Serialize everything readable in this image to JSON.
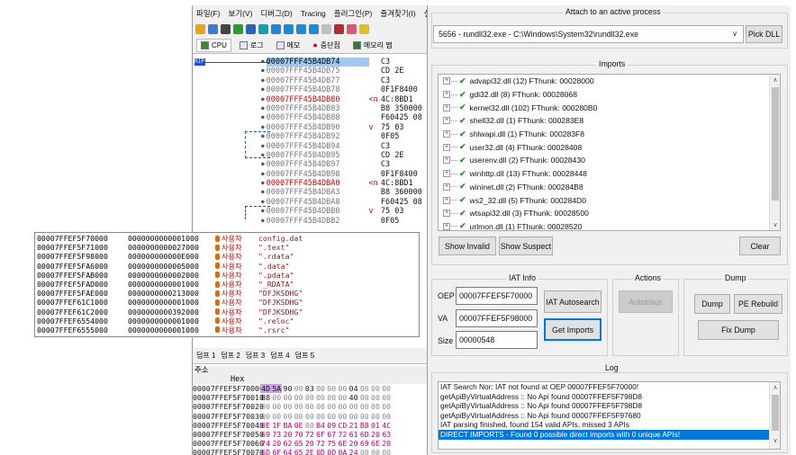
{
  "debugger": {
    "menu": [
      "파일(F)",
      "보기(V)",
      "디버그(D)",
      "Tracing",
      "플러그인(P)",
      "즐겨찾기(I)",
      "설"
    ],
    "tabs": [
      "CPU",
      "로그",
      "메모",
      "중단점",
      "메모리 맵"
    ],
    "rip_label": "RIP",
    "disasm_rows": [
      {
        "addr": "00007FFF45B4DB74",
        "bytes": "C3",
        "selected": true
      },
      {
        "addr": "00007FFF45B4DB75",
        "bytes": "CD 2E"
      },
      {
        "addr": "00007FFF45B4DB77",
        "bytes": "C3"
      },
      {
        "addr": "00007FFF45B4DB78",
        "bytes": "0F1F8400"
      },
      {
        "addr": "00007FFF45B4DB80",
        "bytes": "4C:8BD1",
        "red": true,
        "marker": "<n"
      },
      {
        "addr": "00007FFF45B4DB83",
        "bytes": "B8 350000"
      },
      {
        "addr": "00007FFF45B4DB88",
        "bytes": "F60425 08"
      },
      {
        "addr": "00007FFF45B4DB90",
        "bytes": "75 03",
        "marker": "v"
      },
      {
        "addr": "00007FFF45B4DB92",
        "bytes": "0F05"
      },
      {
        "addr": "00007FFF45B4DB94",
        "bytes": "C3"
      },
      {
        "addr": "00007FFF45B4DB95",
        "bytes": "CD 2E"
      },
      {
        "addr": "00007FFF45B4DB97",
        "bytes": "C3"
      },
      {
        "addr": "00007FFF45B4DB98",
        "bytes": "0F1F8400"
      },
      {
        "addr": "00007FFF45B4DBA0",
        "bytes": "4C:8BD1",
        "red": true,
        "marker": "<n"
      },
      {
        "addr": "00007FFF45B4DBA3",
        "bytes": "B8 360000"
      },
      {
        "addr": "00007FFF45B4DBA8",
        "bytes": "F60425 08"
      },
      {
        "addr": "00007FFF45B4DBB0",
        "bytes": "75 03",
        "marker": "v"
      },
      {
        "addr": "00007FFF45B4DBB2",
        "bytes": "0F05"
      }
    ],
    "dump_tabs": [
      "덤프 1",
      "덤프 2",
      "덤프 3",
      "덤프 4",
      "덤프 5"
    ],
    "dump_col_addr": "주소",
    "dump_col_hex": "Hex",
    "dump_rows": [
      {
        "addr": "00007FFEF5F70000",
        "hex": "4D 5A 90 00 03 00 00 00 04 00 00 00"
      },
      {
        "addr": "00007FFEF5F70010",
        "hex": "B8 00 00 00 00 00 00 00 40 00 00 00"
      },
      {
        "addr": "00007FFEF5F70020",
        "hex": "00 00 00 00 00 00 00 00 00 00 00 00"
      },
      {
        "addr": "00007FFEF5F70030",
        "hex": "00 00 00 00 00 00 00 00 00 00 00 00"
      },
      {
        "addr": "00007FFEF5F70040",
        "hex": "0E 1F BA 0E 00 B4 09 CD 21 B8 01 4C"
      },
      {
        "addr": "00007FFEF5F70050",
        "hex": "69 73 20 70 72 6F 67 72 61 6D 20 63"
      },
      {
        "addr": "00007FFEF5F70060",
        "hex": "74 20 62 65 20 72 75 6E 20 69 6E 20"
      },
      {
        "addr": "00007FFEF5F70070",
        "hex": "6D 6F 64 65 2E 0D 0D 0A 24 00 00 00"
      }
    ]
  },
  "memmap": {
    "rows": [
      {
        "addr": "00007FFEF5F70000",
        "size": "0000000000001000",
        "type": "사용자",
        "info": "config.dat"
      },
      {
        "addr": "00007FFEF5F71000",
        "size": "0000000000027000",
        "type": "사용자",
        "info": "\".text\""
      },
      {
        "addr": "00007FFEF5F98000",
        "size": "000000000000E000",
        "type": "사용자",
        "info": "\".rdata\""
      },
      {
        "addr": "00007FFEF5FA6000",
        "size": "0000000000005000",
        "type": "사용자",
        "info": "\".data\""
      },
      {
        "addr": "00007FFEF5FAB000",
        "size": "0000000000002000",
        "type": "사용자",
        "info": "\".pdata\""
      },
      {
        "addr": "00007FFEF5FAD000",
        "size": "0000000000001000",
        "type": "사용자",
        "info": "\"_RDATA\""
      },
      {
        "addr": "00007FFEF5FAE000",
        "size": "0000000000213000",
        "type": "사용자",
        "info": "\"DFJKSDHG\""
      },
      {
        "addr": "00007FFEF61C1000",
        "size": "0000000000001000",
        "type": "사용자",
        "info": "\"DFJKSDHG\""
      },
      {
        "addr": "00007FFEF61C2000",
        "size": "0000000000392000",
        "type": "사용자",
        "info": "\"DFJKSDHG\""
      },
      {
        "addr": "00007FFEF6554000",
        "size": "0000000000001000",
        "type": "사용자",
        "info": "\".reloc\""
      },
      {
        "addr": "00007FFEF6555000",
        "size": "0000000000001000",
        "type": "사용자",
        "info": "\".rsrc\""
      }
    ]
  },
  "scylla": {
    "attach_label": "Attach to an active process",
    "process": "5656 - rundll32.exe - C:\\Windows\\System32\\rundll32.exe",
    "pick_dll": "Pick DLL",
    "imports_label": "Imports",
    "imports": [
      "advapi32.dll (12) FThunk: 00028000",
      "gdi32.dll (8) FThunk: 00028068",
      "kernel32.dll (102) FThunk: 000280B0",
      "shell32.dll (1) FThunk: 000283E8",
      "shlwapi.dll (1) FThunk: 000283F8",
      "user32.dll (4) FThunk: 00028408",
      "userenv.dll (2) FThunk: 00028430",
      "winhttp.dll (13) FThunk: 00028448",
      "wininet.dll (2) FThunk: 000284B8",
      "ws2_32.dll (5) FThunk: 000284D0",
      "wtsapi32.dll (3) FThunk: 00028500",
      "urlmon.dll (1) FThunk: 00028520"
    ],
    "show_invalid": "Show Invalid",
    "show_suspect": "Show Suspect",
    "clear": "Clear",
    "iat_label": "IAT Info",
    "oep_label": "OEP",
    "oep_value": "00007FFEF5F70000",
    "va_label": "VA",
    "va_value": "00007FFEF5F98000",
    "size_label": "Size",
    "size_value": "00000548",
    "iat_autosearch": "IAT Autosearch",
    "get_imports": "Get Imports",
    "actions_label": "Actions",
    "autotrace": "Autotrace",
    "dump_label": "Dump",
    "dump_btn": "Dump",
    "pe_rebuild": "PE Rebuild",
    "fix_dump": "Fix Dump",
    "log_label": "Log",
    "log": [
      "IAT Search Nor: IAT not found at OEP 00007FFEF5F70000!",
      "getApiByVirtualAddress :: No Api found 00007FFEF5F798D8",
      "getApiByVirtualAddress :: No Api found 00007FFEF5F798D8",
      "getApiByVirtualAddress :: No Api found 00007FFEF5F97680",
      "IAT parsing finished, found 154 valid APIs, missed 3 APIs",
      "DIRECT IMPORTS - Found 0 possible direct imports with 0 unique APIs!"
    ]
  }
}
